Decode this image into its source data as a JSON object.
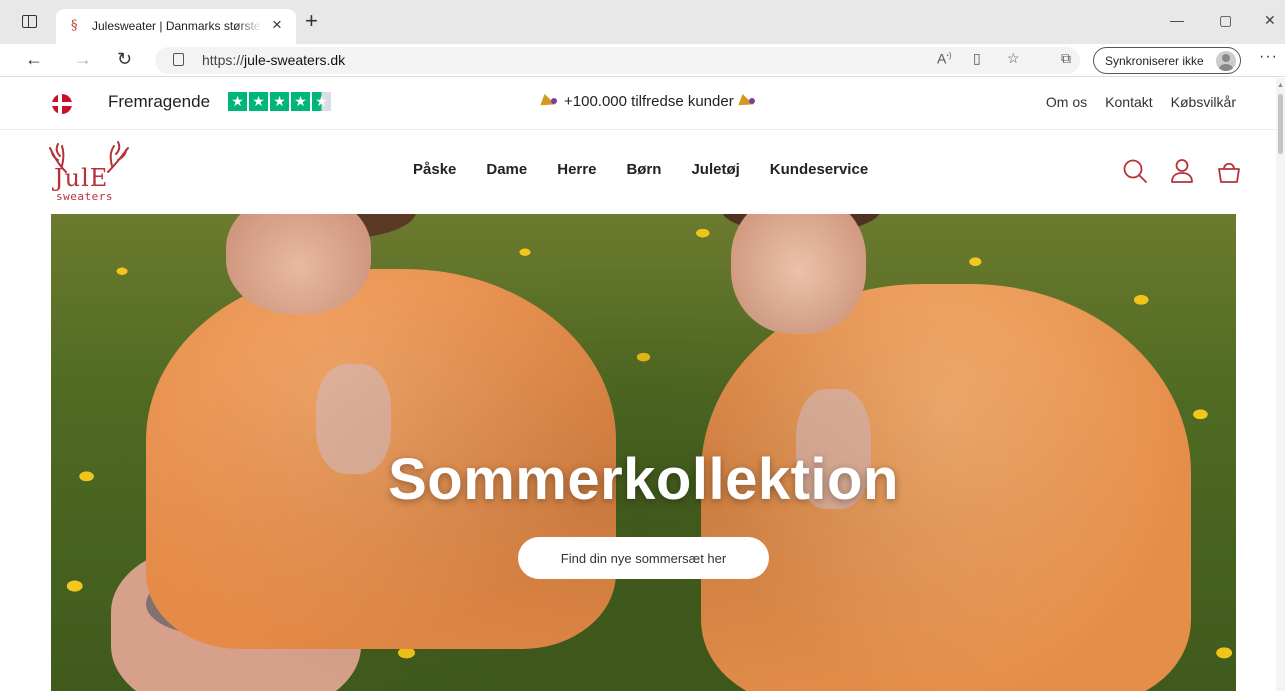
{
  "browser": {
    "tab": {
      "title": "Julesweater | Danmarks største u",
      "favicon": "§"
    },
    "new_tab": "+",
    "url_prefix": "https://",
    "url_domain": "jule-sweaters.dk",
    "sync_label": "Synkroniserer ikke",
    "window_controls": {
      "minimize": "—",
      "restore": "▢",
      "close": "✕"
    },
    "icons": [
      "sidebar-icon",
      "back-icon",
      "forward-icon",
      "refresh-icon",
      "lock-icon",
      "read-aloud-icon",
      "immersive-reader-icon",
      "favorite-icon",
      "collections-icon",
      "more-icon"
    ]
  },
  "topbar": {
    "rating_label": "Fremragende",
    "promo_text": "+100.000 tilfredse kunder",
    "links": [
      "Om os",
      "Kontakt",
      "Købsvilkår"
    ]
  },
  "header": {
    "logo_word": "JulE",
    "logo_sub": "sweaters",
    "menu": [
      "Påske",
      "Dame",
      "Herre",
      "Børn",
      "Juletøj",
      "Kundeservice"
    ]
  },
  "hero": {
    "title": "Sommerkollektion",
    "cta": "Find din nye sommersæt her"
  },
  "colors": {
    "brand_red": "#b73238",
    "trustpilot_green": "#00b67a"
  }
}
